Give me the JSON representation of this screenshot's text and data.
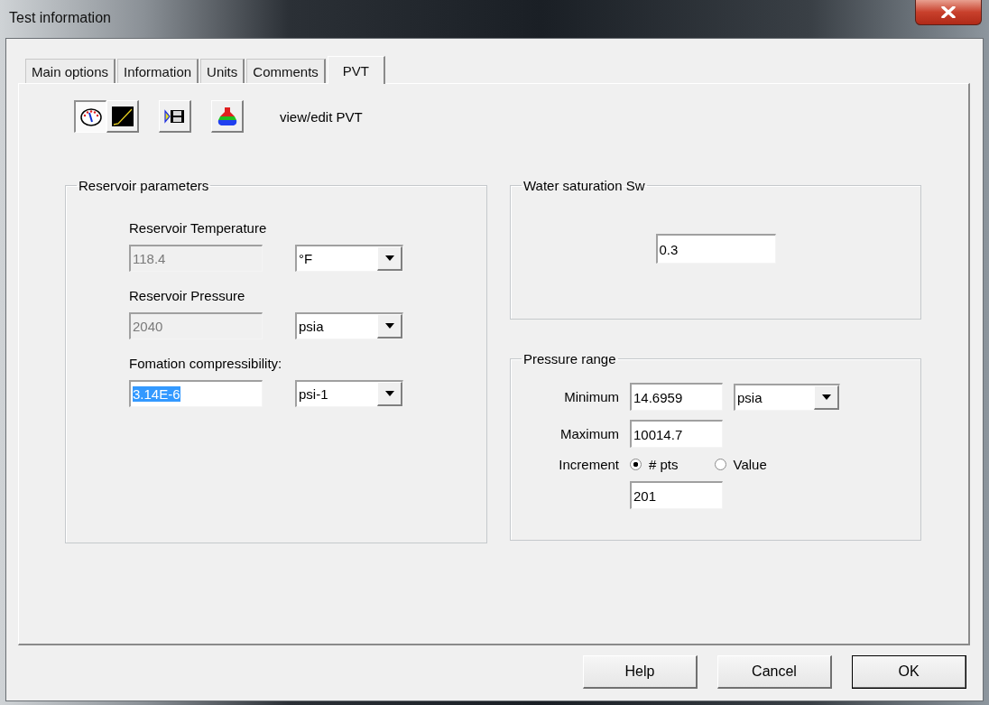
{
  "window": {
    "title": "Test information"
  },
  "tabs": [
    {
      "label": "Main options",
      "selected": false
    },
    {
      "label": "Information",
      "selected": false
    },
    {
      "label": "Units",
      "selected": false
    },
    {
      "label": "Comments",
      "selected": false
    },
    {
      "label": "PVT",
      "selected": true
    }
  ],
  "toolbar": {
    "buttons": [
      {
        "kind": "gauge",
        "selected": true
      },
      {
        "kind": "curve",
        "selected": false
      },
      {
        "kind": "export",
        "selected": false
      },
      {
        "kind": "flask",
        "selected": false
      }
    ],
    "caption": "view/edit PVT"
  },
  "reservoir_parameters": {
    "title": "Reservoir parameters",
    "rows": [
      {
        "label": "Reservoir Temperature",
        "value": "118.4",
        "disabled": true,
        "text_selected": false,
        "unit": "°F"
      },
      {
        "label": "Reservoir Pressure",
        "value": "2040",
        "disabled": true,
        "text_selected": false,
        "unit": "psia"
      },
      {
        "label": "Fomation compressibility:",
        "value": "3.14E-6",
        "disabled": false,
        "text_selected": true,
        "unit": "psi-1"
      }
    ]
  },
  "water_saturation": {
    "title": "Water saturation Sw",
    "value": "0.3"
  },
  "pressure_range": {
    "title": "Pressure range",
    "minimum": {
      "label": "Minimum",
      "value": "14.6959",
      "unit": "psia"
    },
    "maximum": {
      "label": "Maximum",
      "value": "10014.7"
    },
    "increment": {
      "label": "Increment",
      "options": [
        {
          "label": "# pts",
          "selected": true
        },
        {
          "label": "Value",
          "selected": false
        }
      ],
      "value": "201"
    }
  },
  "buttons": [
    {
      "label": "Help",
      "default": false
    },
    {
      "label": "Cancel",
      "default": false
    },
    {
      "label": "OK",
      "default": true
    }
  ]
}
